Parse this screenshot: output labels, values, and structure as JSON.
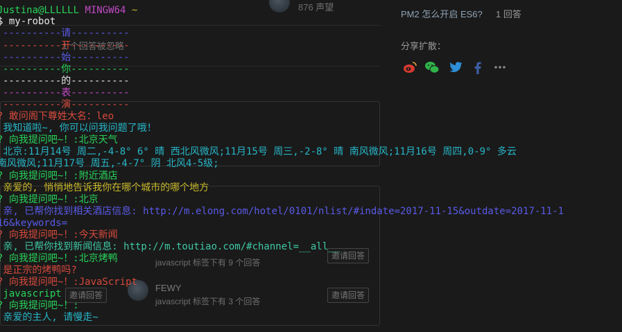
{
  "background_page": {
    "header_count": "876 声望",
    "answer_prompt": "1 个回答被忽略",
    "invite_button": "邀请回答",
    "users": [
      {
        "name": "FEWY",
        "desc": "javascript 标签下有 9 个回答"
      },
      {
        "name": "FEWY",
        "desc": "javascript 标签下有 3 个回答"
      }
    ],
    "sidebar": {
      "related_question": "PM2 怎么开启 ES6?",
      "related_count": "1 回答",
      "share_label": "分享扩散："
    },
    "share_icons": [
      "weibo-icon",
      "wechat-icon",
      "twitter-icon",
      "facebook-icon",
      "more-icon"
    ]
  },
  "terminal": {
    "prompt_user": "Justina@LLLLLL",
    "prompt_env": "MINGW64",
    "prompt_path": "~",
    "prompt_symbol": "$",
    "command": "my-robot",
    "banner": [
      "----------请----------",
      "----------开----------",
      "----------始----------",
      "----------你----------",
      "----------的----------",
      "----------表----------",
      "----------演----------"
    ],
    "lines": [
      {
        "text": "? 敢问阁下尊姓大名：leo"
      },
      {
        "text": " 我知道啦~, 你可以问我问题了哦！"
      },
      {
        "text": "? 向我提问吧~！:北京天气"
      },
      {
        "text": " 北京:11月14号 周二,-4-8° 6° 晴 西北风微风;11月15号 周三,-2-8° 晴 南风微风;11月16号 周四,0-9° 多云"
      },
      {
        "text": "南风微风;11月17号 周五,-4-7° 阴 北风4-5级;"
      },
      {
        "text": "? 向我提问吧~！:附近酒店"
      },
      {
        "text": " 亲爱的, 悄悄地告诉我你在哪个城市的哪个地方"
      },
      {
        "text": "? 向我提问吧~！:北京"
      },
      {
        "text": " 亲, 已帮你找到相关酒店信息: http://m.elong.com/hotel/0101/nlist/#indate=2017-11-15&outdate=2017-11-1"
      },
      {
        "text": "16&keywords="
      },
      {
        "text": "? 向我提问吧~！:今天新闻"
      },
      {
        "text": " 亲, 已帮你找到新闻信息: http://m.toutiao.com/#channel=__all__"
      },
      {
        "text": "? 向我提问吧~！:北京烤鸭"
      },
      {
        "text": " 是正宗的烤鸭吗?"
      },
      {
        "text": "? 向我提问吧~！:JavaScript"
      },
      {
        "text": " javascript"
      },
      {
        "text": "? 向我提问吧~！:"
      },
      {
        "text": " 亲爱的主人, 请慢走~"
      }
    ]
  },
  "colors": {
    "green": "#28d45a",
    "purple": "#c24ac6",
    "red": "#d84a3e",
    "cyan": "#27b6c8",
    "yellow": "#c8b92a",
    "blue": "#5a5ae8",
    "white": "#e8e8e8"
  }
}
